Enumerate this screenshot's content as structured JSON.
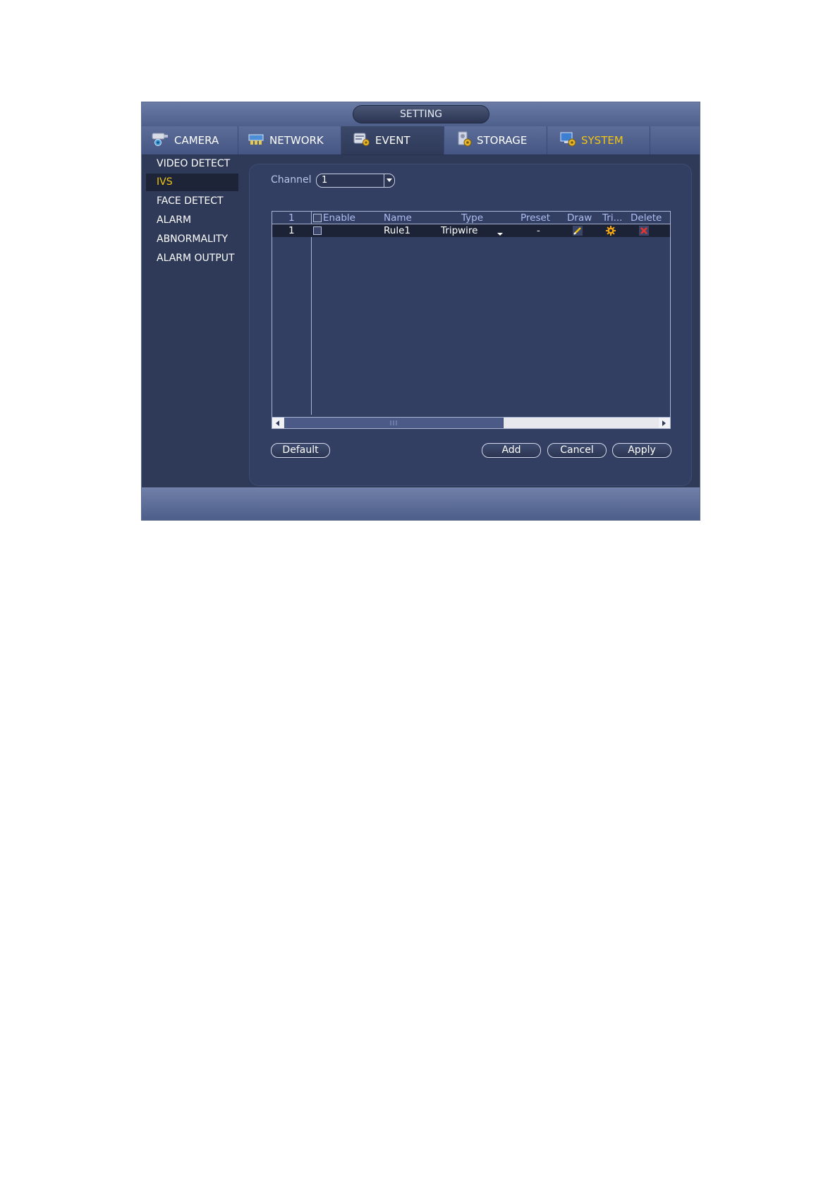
{
  "window": {
    "title": "SETTING"
  },
  "tabs": [
    {
      "label": "CAMERA",
      "icon": "camera-icon"
    },
    {
      "label": "NETWORK",
      "icon": "network-icon"
    },
    {
      "label": "EVENT",
      "icon": "event-icon",
      "active": true
    },
    {
      "label": "STORAGE",
      "icon": "storage-icon"
    },
    {
      "label": "SYSTEM",
      "icon": "system-icon",
      "color": "#f2c511"
    }
  ],
  "sidebar": {
    "items": [
      {
        "label": "VIDEO DETECT"
      },
      {
        "label": "IVS",
        "active": true
      },
      {
        "label": "FACE DETECT"
      },
      {
        "label": "ALARM"
      },
      {
        "label": "ABNORMALITY"
      },
      {
        "label": "ALARM OUTPUT"
      }
    ]
  },
  "channel": {
    "label": "Channel",
    "value": "1"
  },
  "table": {
    "headers": {
      "index": "1",
      "enable": "Enable",
      "name": "Name",
      "type": "Type",
      "preset": "Preset",
      "draw": "Draw",
      "trigger": "Tri...",
      "delete": "Delete"
    },
    "rows": [
      {
        "index": "1",
        "enabled": false,
        "name": "Rule1",
        "type": "Tripwire",
        "preset": "-",
        "draw_icon": "pencil-icon",
        "trigger_icon": "gear-icon",
        "delete_icon": "delete-x-icon"
      }
    ]
  },
  "buttons": {
    "default": "Default",
    "add": "Add",
    "cancel": "Cancel",
    "apply": "Apply"
  },
  "colors": {
    "accent": "#f2c511",
    "panel": "#333f62",
    "header_text": "#aebcf0"
  }
}
